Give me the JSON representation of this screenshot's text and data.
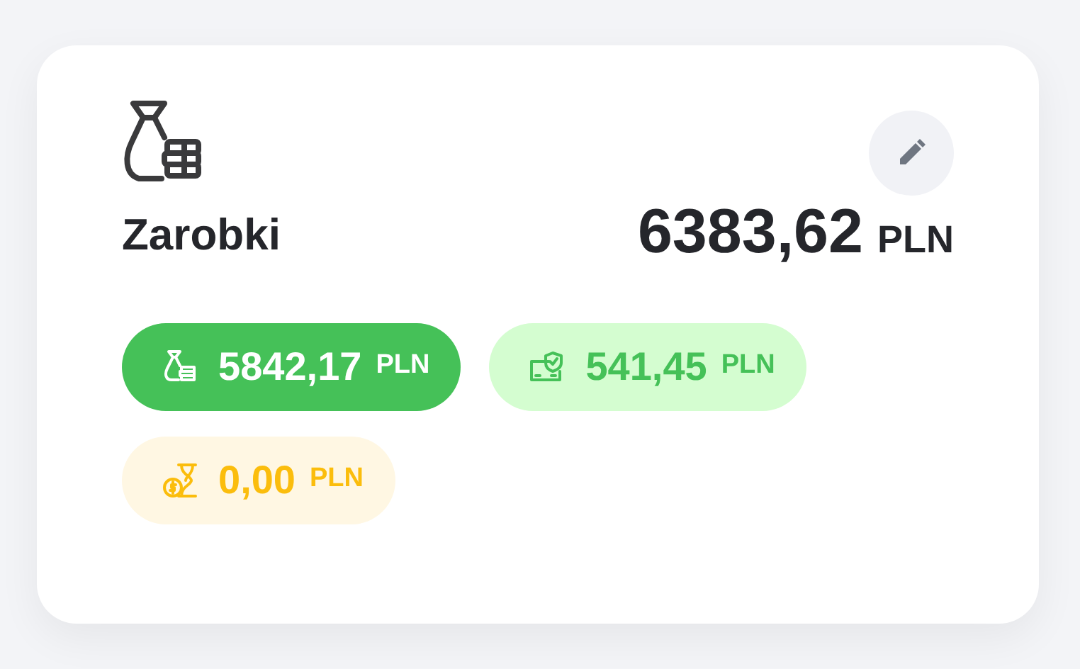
{
  "card": {
    "title": "Zarobki",
    "total": {
      "amount": "6383,62",
      "currency": "PLN"
    },
    "pills": [
      {
        "kind": "earned",
        "amount": "5842,17",
        "currency": "PLN"
      },
      {
        "kind": "bonus",
        "amount": "541,45",
        "currency": "PLN"
      },
      {
        "kind": "pending",
        "amount": "0,00",
        "currency": "PLN"
      }
    ]
  }
}
